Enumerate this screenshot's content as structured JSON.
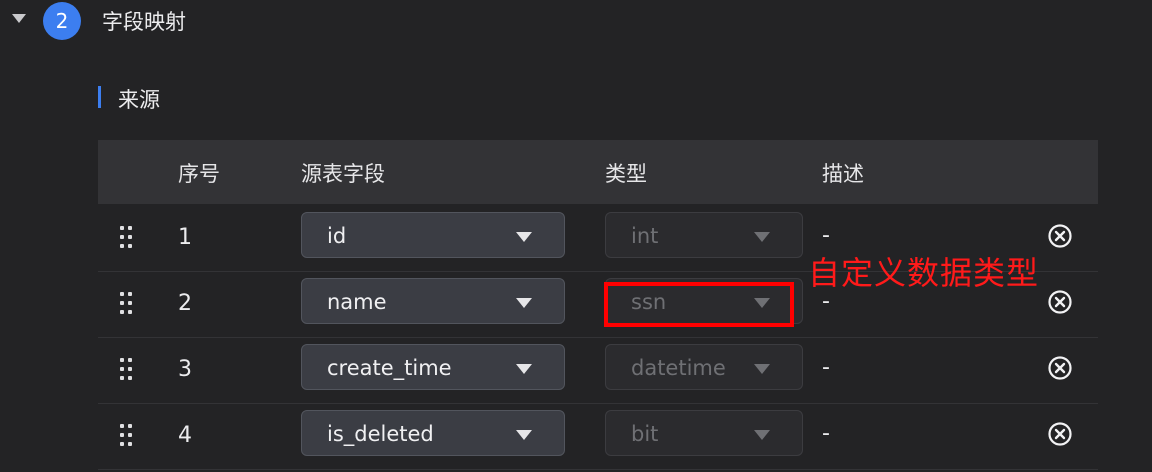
{
  "step": {
    "number": "2",
    "title": "字段映射",
    "collapse_icon": "triangle-down-icon"
  },
  "section": {
    "title": "来源",
    "accent_color": "#3c7ef0"
  },
  "table": {
    "columns": [
      "序号",
      "源表字段",
      "类型",
      "描述"
    ],
    "rows": [
      {
        "seq": "1",
        "source_field": "id",
        "type": "int",
        "description": "-"
      },
      {
        "seq": "2",
        "source_field": "name",
        "type": "ssn",
        "description": "-"
      },
      {
        "seq": "3",
        "source_field": "create_time",
        "type": "datetime",
        "description": "-"
      },
      {
        "seq": "4",
        "source_field": "is_deleted",
        "type": "bit",
        "description": "-"
      }
    ]
  },
  "annotation": {
    "text": "自定义数据类型",
    "color": "#ff0000"
  },
  "icons": {
    "drag": "drag-handle-icon",
    "remove": "close-circle-icon",
    "dropdown": "caret-down-icon"
  }
}
